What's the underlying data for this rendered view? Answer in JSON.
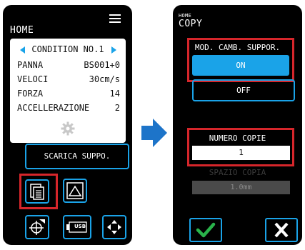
{
  "left_screen": {
    "title": "HOME",
    "condition_label": "CONDITION NO.1",
    "params": [
      {
        "key": "PANNA",
        "value": "BS001+0"
      },
      {
        "key": "VELOCI",
        "value": "30cm/s"
      },
      {
        "key": "FORZA",
        "value": "14"
      },
      {
        "key": "ACCELLERAZIONE",
        "value": "2"
      }
    ],
    "feed_button_label": "SCARICA SUPPO.",
    "usb_label": "USB"
  },
  "right_screen": {
    "breadcrumb": "HOME",
    "title": "COPY",
    "media_change_label": "MOD. CAMB. SUPPOR.",
    "on_label": "ON",
    "off_label": "OFF",
    "copies_label": "NUMERO COPIE",
    "copies_value": "1",
    "spacing_label": "SPAZIO COPIA",
    "spacing_value": "1.0mm"
  },
  "colors": {
    "accent": "#1aa3e8",
    "highlight": "#d6262b",
    "confirm": "#29b24a",
    "background": "#000000"
  }
}
